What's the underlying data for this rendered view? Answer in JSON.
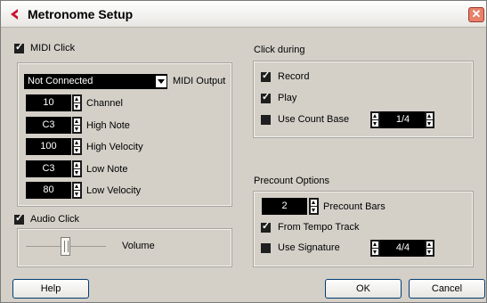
{
  "window": {
    "title": "Metronome Setup"
  },
  "midi_click": {
    "enabled": true,
    "label": "MIDI Click",
    "output": {
      "value": "Not Connected",
      "label": "MIDI Output"
    },
    "fields": [
      {
        "value": "10",
        "label": "Channel"
      },
      {
        "value": "C3",
        "label": "High Note"
      },
      {
        "value": "100",
        "label": "High Velocity"
      },
      {
        "value": "C3",
        "label": "Low Note"
      },
      {
        "value": "80",
        "label": "Low Velocity"
      }
    ]
  },
  "audio_click": {
    "enabled": true,
    "label": "Audio Click",
    "volume_label": "Volume"
  },
  "click_during": {
    "title": "Click during",
    "record": {
      "label": "Record",
      "checked": true
    },
    "play": {
      "label": "Play",
      "checked": true
    },
    "use_count_base": {
      "label": "Use Count Base",
      "checked": false,
      "value": "1/4"
    }
  },
  "precount": {
    "title": "Precount Options",
    "bars": {
      "value": "2",
      "label": "Precount Bars"
    },
    "from_tempo_track": {
      "label": "From Tempo Track",
      "checked": true
    },
    "use_signature": {
      "label": "Use Signature",
      "checked": false,
      "value": "4/4"
    }
  },
  "buttons": {
    "help": "Help",
    "ok": "OK",
    "cancel": "Cancel"
  },
  "icons": {
    "logo": "cubase-logo-icon",
    "close": "close-icon"
  },
  "colors": {
    "window_bg": "#d4d0c8",
    "field_bg": "#000000",
    "logo_red": "#c8102e",
    "close_bg": "#e8806a"
  }
}
